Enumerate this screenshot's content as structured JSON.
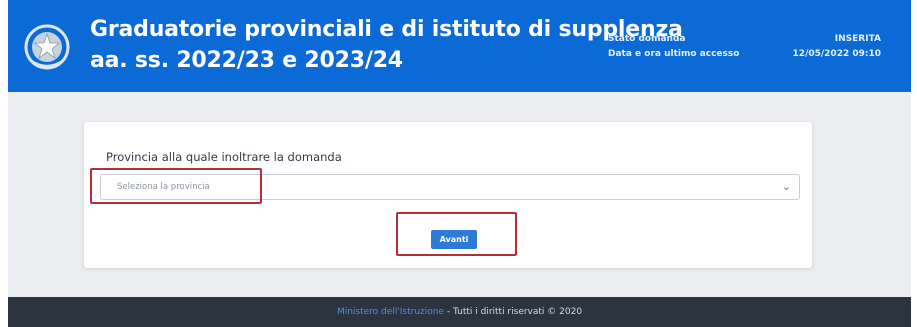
{
  "header": {
    "title_line1": "Graduatorie provinciali e di istituto di supplenza",
    "title_line2": "aa. ss. 2022/23 e 2023/24",
    "status_label": "Stato domanda",
    "status_value": "INSERITA",
    "last_access_label": "Data e ora ultimo accesso",
    "last_access_value": "12/05/2022 09:10"
  },
  "form": {
    "province_label": "Provincia alla quale inoltrare la domanda",
    "province_placeholder": "Seleziona la provincia",
    "submit_label": "Avanti"
  },
  "footer": {
    "link_text": "Ministero dell'Istruzione",
    "rights_text": " - Tutti i diritti riservati © 2020"
  },
  "colors": {
    "header_bg": "#0c6ad6",
    "button_bg": "#2e7ad9",
    "highlight_border": "#b3303a",
    "footer_bg": "#2c3440"
  },
  "icons": {
    "header_emblem": "italian-republic-emblem-icon",
    "select_arrow": "chevron-down-icon"
  }
}
